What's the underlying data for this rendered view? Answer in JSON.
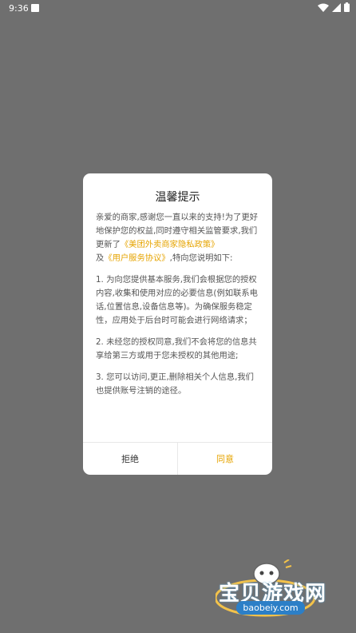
{
  "status_bar": {
    "time": "9:36",
    "icons": [
      "wifi-icon",
      "signal-icon",
      "battery-icon"
    ]
  },
  "dialog": {
    "title": "温馨提示",
    "intro_prefix": "亲爱的商家,感谢您一直以来的支持!为了更好地保护您的权益,同时遵守相关监管要求,我们更新了",
    "privacy_link": "《美团外卖商家隐私政策》",
    "intro_and": "及",
    "service_link": "《用户服务协议》",
    "intro_suffix": ",特向您说明如下:",
    "points": [
      "1. 为向您提供基本服务,我们会根据您的授权内容,收集和使用对应的必要信息(例如联系电话,位置信息,设备信息等)。为确保服务稳定性，应用处于后台时可能会进行网络请求；",
      "2. 未经您的授权同意,我们不会将您的信息共享给第三方或用于您未授权的其他用途;",
      "3. 您可以访问,更正,删除相关个人信息,我们也提供账号注销的途径。"
    ],
    "decline_label": "拒绝",
    "agree_label": "同意"
  },
  "watermark": {
    "name": "宝贝游戏网",
    "url": "baobeiy.com"
  },
  "colors": {
    "accent": "#e6a400",
    "overlay": "#6f6f6f"
  }
}
